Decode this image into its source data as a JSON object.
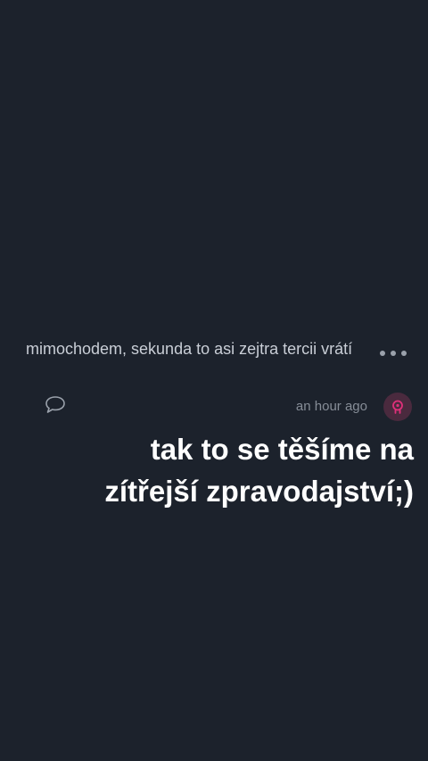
{
  "post": {
    "text": "mimochodem, sekunda to asi zejtra tercii vrátí",
    "timestamp": "an hour ago",
    "icons": {
      "more": "more-dots-icon",
      "comment": "speech-bubble-icon",
      "avatar": "user-avatar-icon"
    }
  },
  "caption": {
    "line1": "tak to se těšíme na",
    "line2": "zítřejší zpravodajství;)"
  },
  "colors": {
    "background": "#1c222c",
    "avatar_bg": "#4a2a3e",
    "avatar_accent": "#e0307a"
  }
}
